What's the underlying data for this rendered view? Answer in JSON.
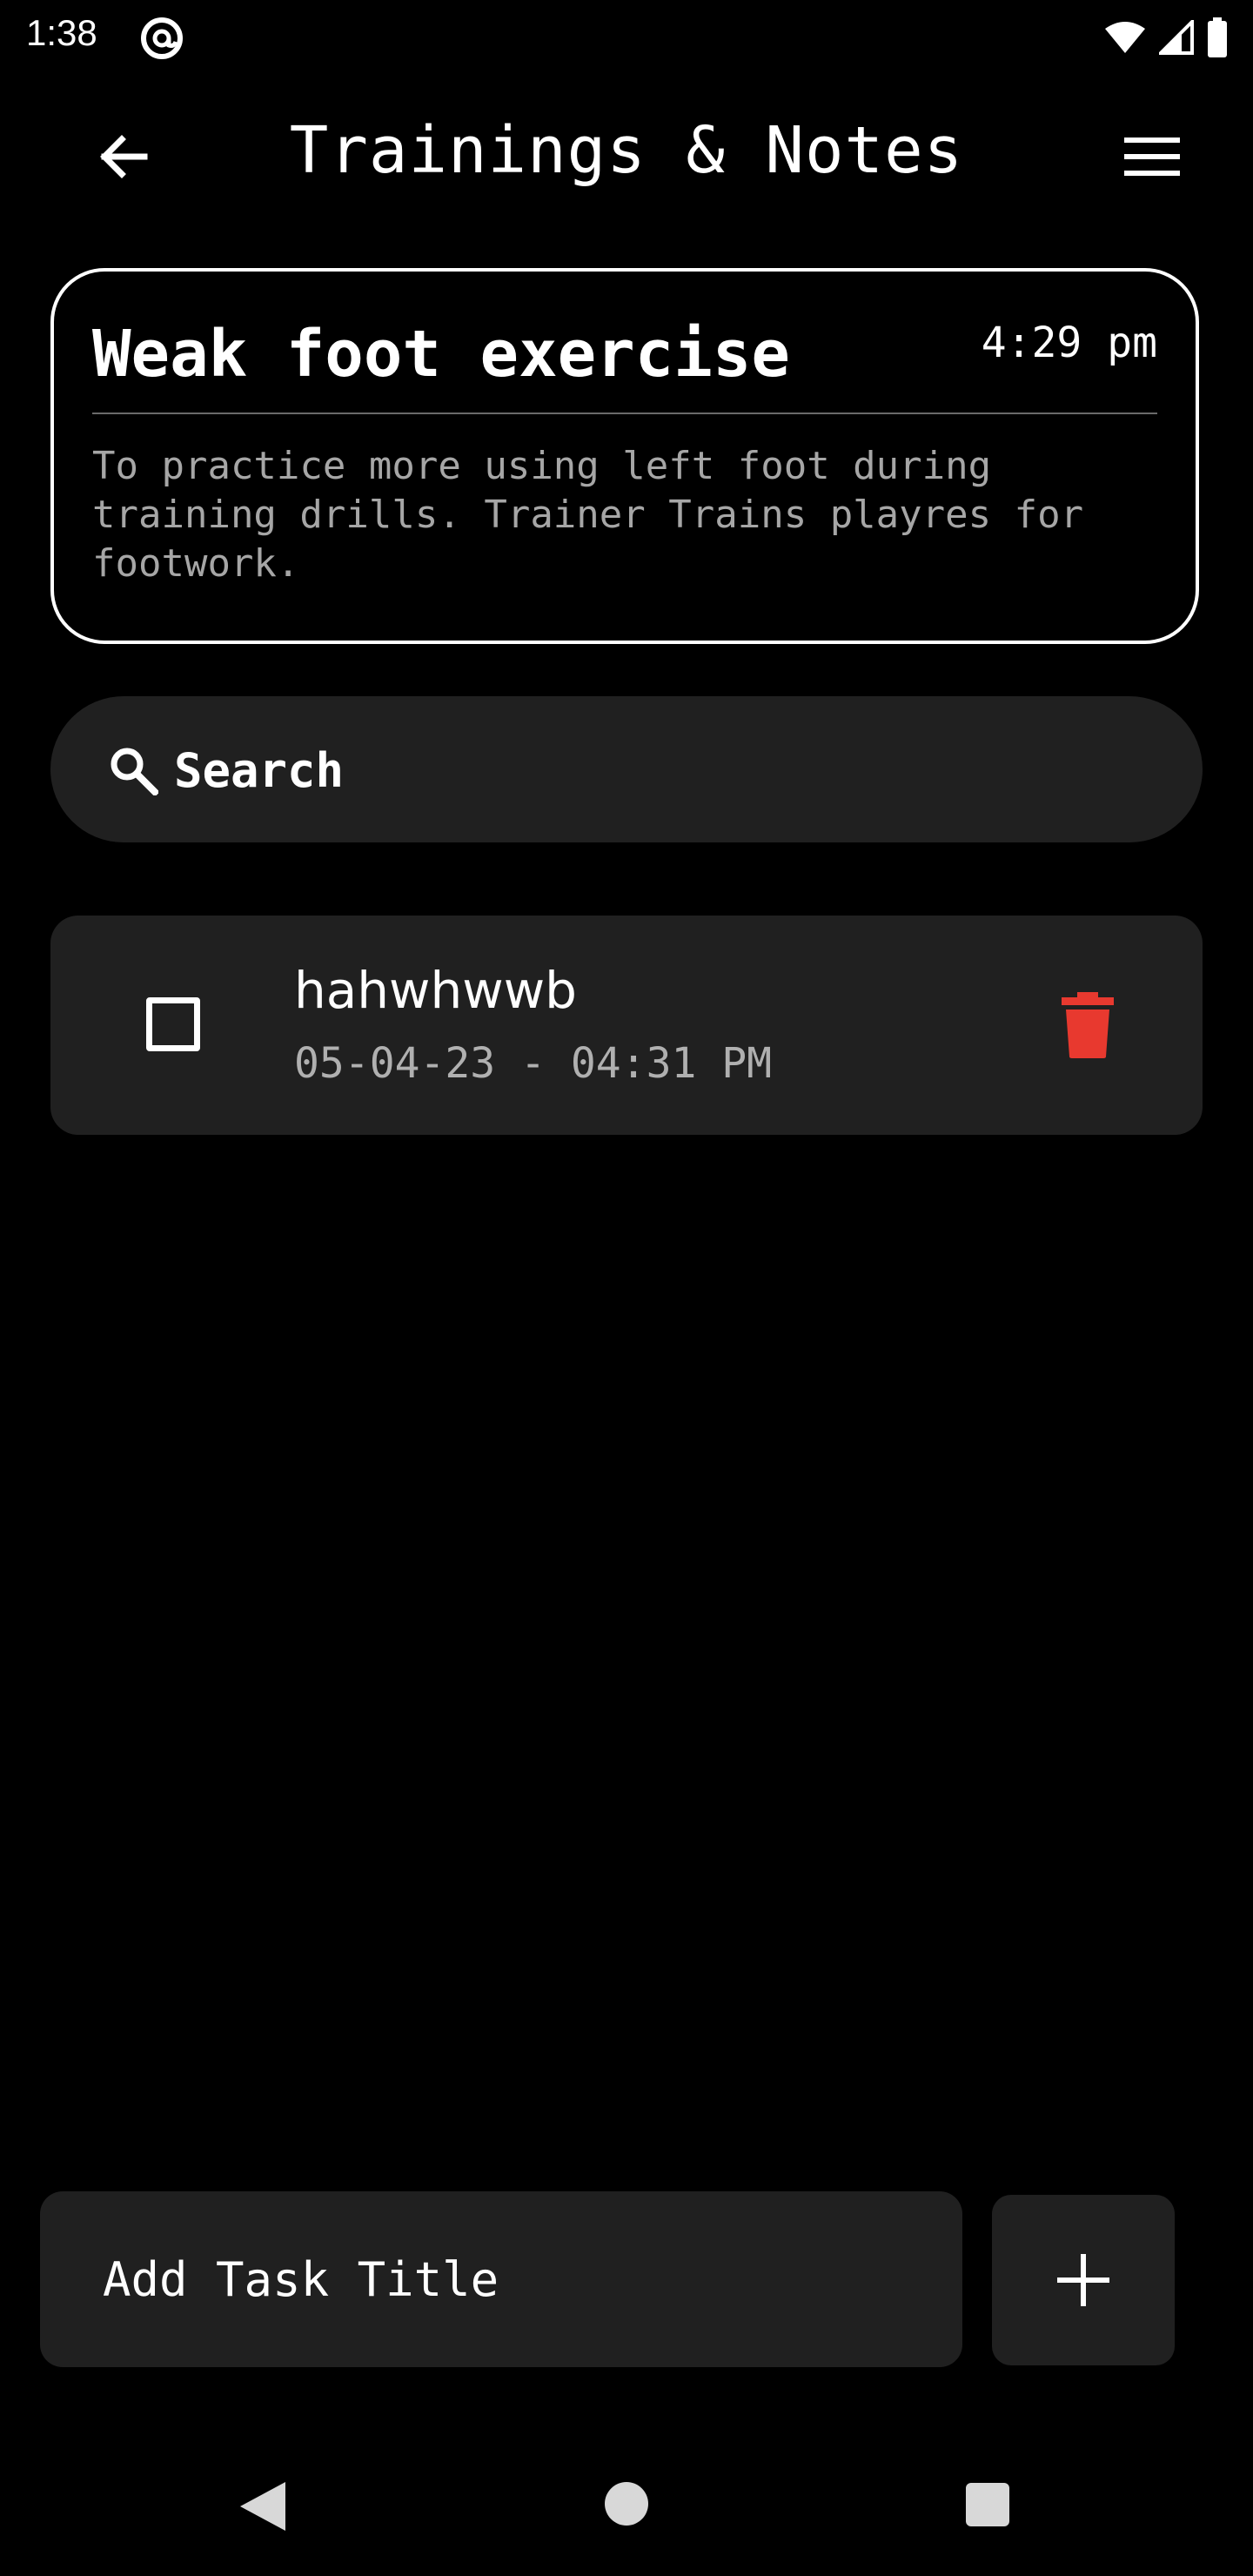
{
  "status_bar": {
    "time": "1:38"
  },
  "app_bar": {
    "title": "Trainings & Notes"
  },
  "note": {
    "title": "Weak foot exercise",
    "time": "4:29 pm",
    "description": "To practice more using left foot during training drills. Trainer Trains playres for footwork."
  },
  "search": {
    "label": "Search"
  },
  "tasks": [
    {
      "title": "hahwhwwb",
      "datetime": "05-04-23 - 04:31 PM",
      "checked": false
    }
  ],
  "add_task": {
    "placeholder": "Add Task Title"
  },
  "icons": {
    "back": "arrow-back-icon",
    "menu": "menu-icon",
    "search": "search-icon",
    "delete": "trash-icon",
    "add": "plus-icon"
  },
  "colors": {
    "background": "#000000",
    "surface": "#202020",
    "delete": "#e8392f",
    "muted_text": "#a6a6a6"
  }
}
